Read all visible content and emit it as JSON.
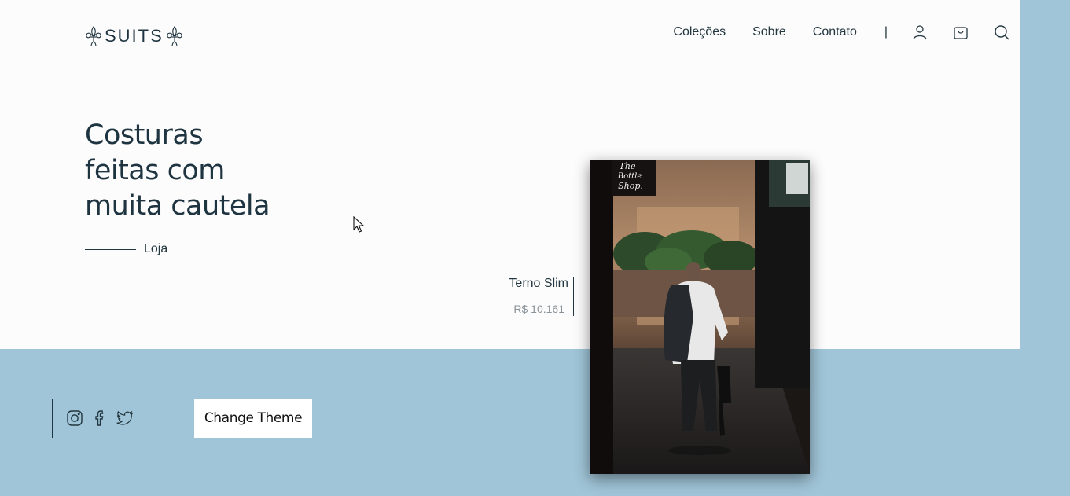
{
  "brand": {
    "name": "SUITS"
  },
  "nav": {
    "links": [
      "Coleções",
      "Sobre",
      "Contato"
    ],
    "separator": "|",
    "icons": [
      "user-icon",
      "bag-icon",
      "search-icon"
    ]
  },
  "hero": {
    "title_lines": [
      "Costuras",
      "feitas com",
      "muita cautela"
    ],
    "cta": "Loja"
  },
  "product": {
    "name": "Terno Slim",
    "price": "R$ 10.161",
    "image_signs": [
      "The",
      "Bottle",
      "Shop."
    ]
  },
  "footer": {
    "social": [
      "instagram-icon",
      "facebook-icon",
      "twitter-icon"
    ],
    "theme_button": "Change Theme"
  },
  "colors": {
    "background_accent": "#a0c5d8",
    "panel": "#fcfcfc",
    "text": "#1e3440"
  }
}
